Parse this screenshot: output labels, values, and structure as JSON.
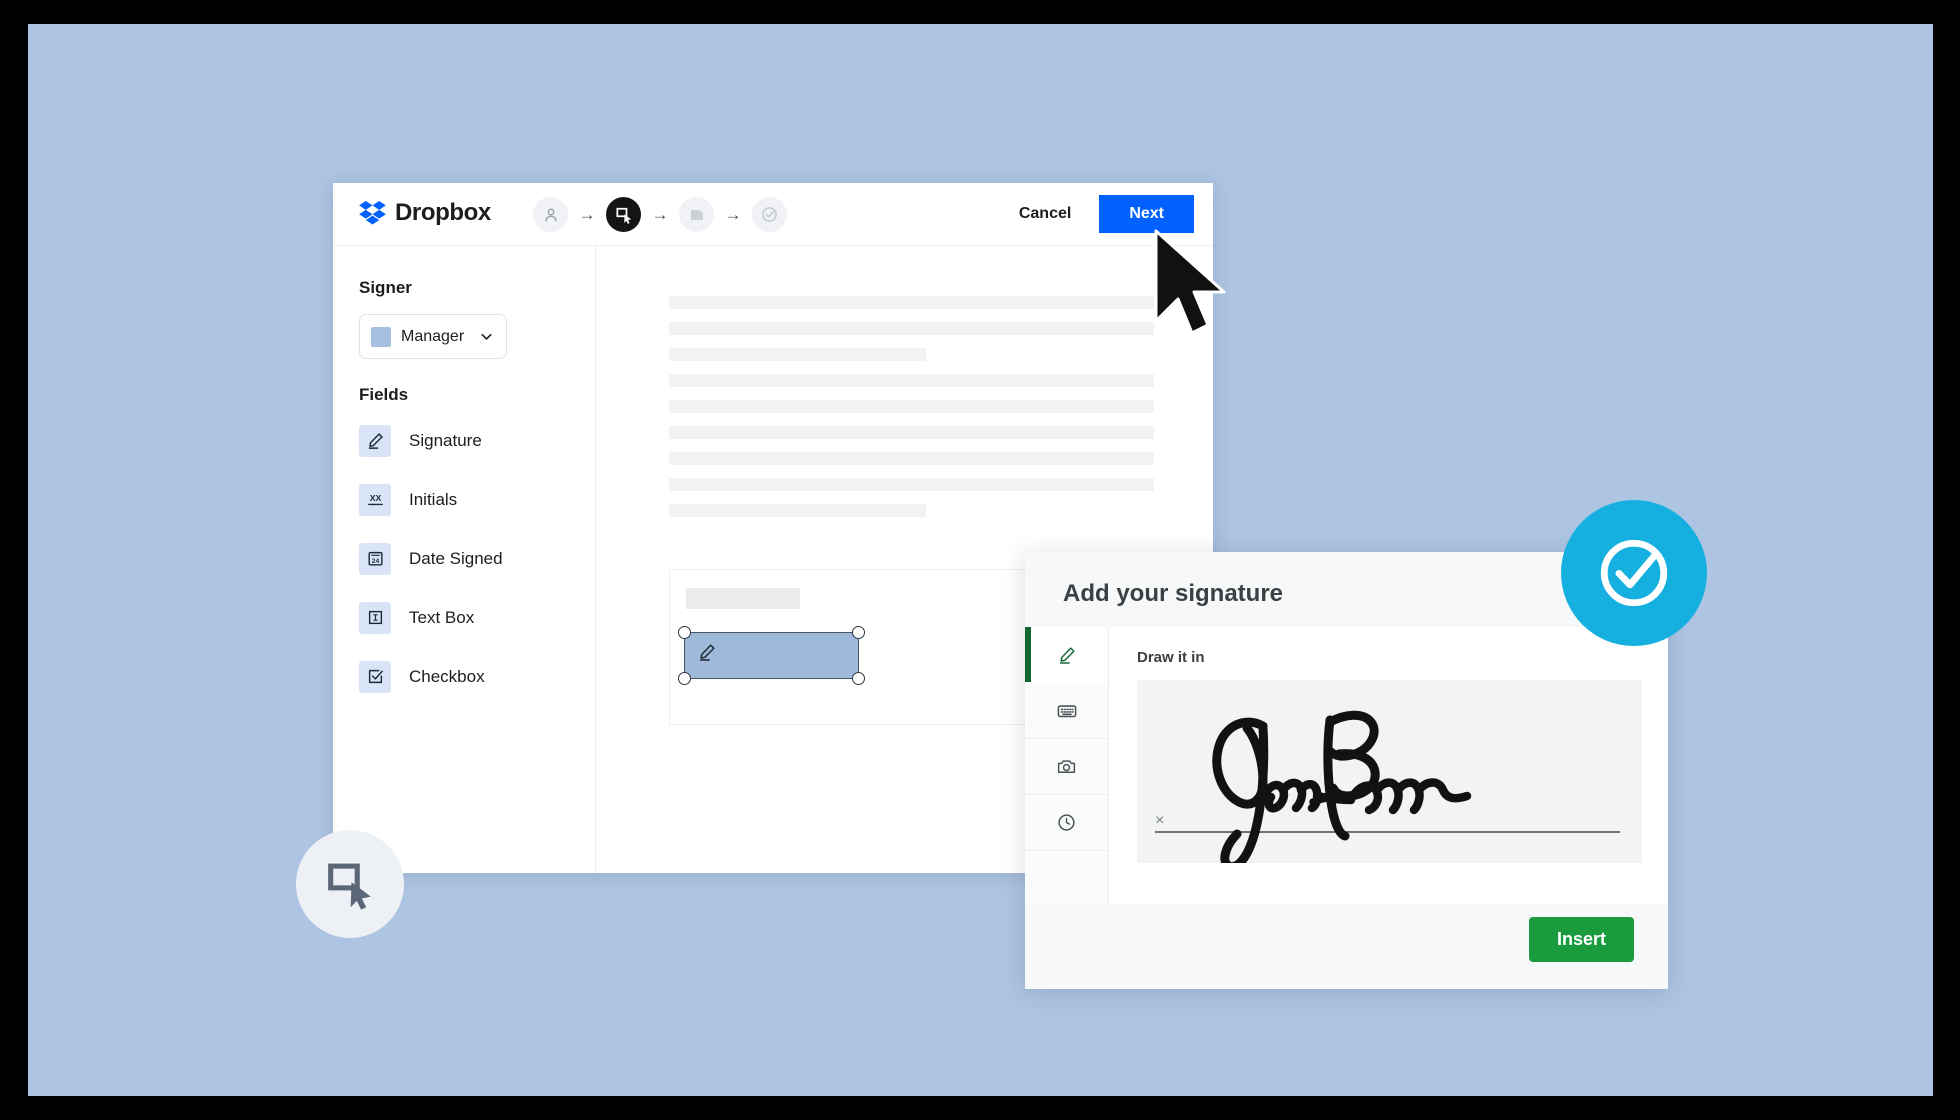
{
  "app": {
    "brand": "Dropbox",
    "brand_color": "#0061fe"
  },
  "header": {
    "steps": [
      {
        "name": "add-signers-step",
        "icon": "person-icon",
        "state": "done"
      },
      {
        "name": "place-fields-step",
        "icon": "drag-field-icon",
        "state": "active"
      },
      {
        "name": "review-document-step",
        "icon": "document-icon",
        "state": "upcoming"
      },
      {
        "name": "send-step",
        "icon": "check-circle-icon",
        "state": "upcoming"
      }
    ],
    "arrow": "→",
    "cancel_label": "Cancel",
    "next_label": "Next",
    "next_color": "#0061fe"
  },
  "sidebar": {
    "signer_title": "Signer",
    "signer_selected": "Manager",
    "signer_swatch_color": "#a7c0e0",
    "fields_title": "Fields",
    "fields": [
      {
        "label": "Signature",
        "icon": "pen-signature-icon"
      },
      {
        "label": "Initials",
        "icon": "initials-xx-icon"
      },
      {
        "label": "Date Signed",
        "icon": "calendar-24-icon"
      },
      {
        "label": "Text Box",
        "icon": "text-box-icon"
      },
      {
        "label": "Checkbox",
        "icon": "checkbox-icon"
      }
    ]
  },
  "document": {
    "placeholder_lines": [
      100,
      100,
      53,
      100,
      100,
      100,
      100,
      100,
      53
    ],
    "field_on_page": {
      "type": "signature",
      "icon": "pen-signature-icon",
      "selected": true,
      "fill_color": "#9fb9da"
    }
  },
  "signature_modal": {
    "title": "Add your signature",
    "tabs": [
      {
        "name": "draw-tab",
        "icon": "pen-icon",
        "active": true
      },
      {
        "name": "type-tab",
        "icon": "keyboard-icon",
        "active": false
      },
      {
        "name": "upload-photo-tab",
        "icon": "camera-icon",
        "active": false
      },
      {
        "name": "saved-signatures-tab",
        "icon": "clock-icon",
        "active": false
      }
    ],
    "draw_label": "Draw it in",
    "signature_line_mark": "×",
    "insert_label": "Insert",
    "insert_color": "#199b3e",
    "active_tab_color": "#14662f"
  },
  "badges": [
    {
      "name": "check-circle-badge",
      "icon": "check-circle-icon",
      "color": "#16b0e0"
    },
    {
      "name": "drag-field-badge",
      "icon": "drag-field-icon",
      "color": "#edf1f6"
    }
  ],
  "cursor": {
    "name": "mouse-pointer",
    "over": "Next"
  }
}
